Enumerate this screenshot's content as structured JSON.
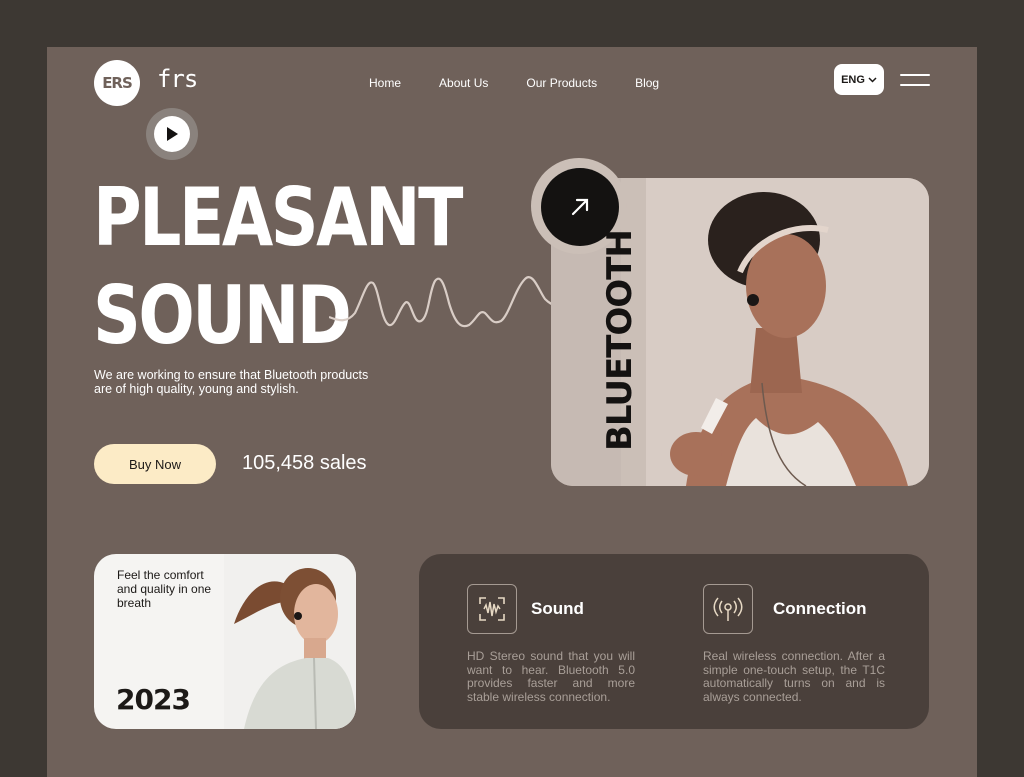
{
  "brand": {
    "logo_mark": "ERS",
    "name": "frs"
  },
  "nav": {
    "items": [
      {
        "label": "Home"
      },
      {
        "label": "About Us"
      },
      {
        "label": "Our Products"
      },
      {
        "label": "Blog"
      }
    ],
    "language": "ENG"
  },
  "hero": {
    "title_line1": "PLEASANT",
    "title_line2": "SOUND",
    "description": "We are working to ensure that Bluetooth products are of high quality, young and stylish.",
    "cta_label": "Buy Now",
    "sales": "105,458 sales",
    "card_label": "BLUETOOTH"
  },
  "promo": {
    "text": "Feel the comfort and quality in one breath",
    "year": "2023"
  },
  "features": [
    {
      "icon": "sound-wave-icon",
      "title": "Sound",
      "description": "HD Stereo sound that you will want to hear. Bluetooth 5.0 provides faster and more stable wireless connection."
    },
    {
      "icon": "wireless-signal-icon",
      "title": "Connection",
      "description": "Real wireless connection. After a simple one-touch setup, the T1C automatically turns on and is always connected."
    }
  ],
  "colors": {
    "outer_bg": "#3d3833",
    "frame_bg": "#6f615a",
    "accent_button": "#fcebc6",
    "panel_bg": "#4a403b",
    "card_bg": "#cbbfb7"
  }
}
